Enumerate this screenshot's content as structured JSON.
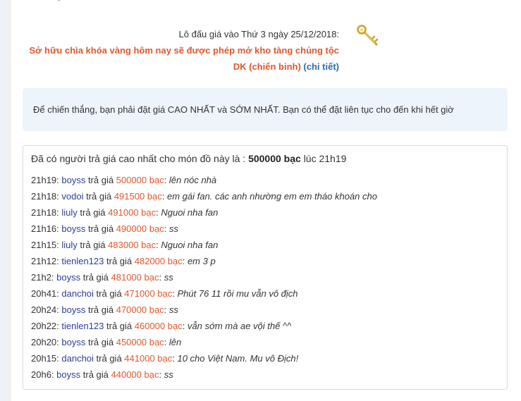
{
  "auction": {
    "date_line": "Lô đấu giá vào Thứ 3 ngày 25/12/2018:",
    "prize_line": "Sở hữu chìa khóa vàng hôm nay sẽ được phép mở kho tàng chủng tộc",
    "clan_name": "DK (chiến binh)",
    "paren_open": "(",
    "details_link": "chi tiết",
    "paren_close": ")"
  },
  "notice": {
    "text": "Để chiến thắng, bạn phải đặt giá CAO NHẤT và SỚM NHẤT. Bạn có thể đặt liên tục cho đến khi hết giờ"
  },
  "top_bid": {
    "prefix": "Đã có người trả giá cao nhất cho món đồ này là : ",
    "amount": "500000 bạc",
    "suffix": " lúc 21h19"
  },
  "labels": {
    "bid_verb": " trả giá ",
    "colon": ": "
  },
  "bids": [
    {
      "time": "21h19:",
      "user": "boyss",
      "amount": "500000 bạc",
      "message": "lên nóc nhà"
    },
    {
      "time": "21h18:",
      "user": "vodoi",
      "amount": "491500 bạc",
      "message": "em gái fan. các anh nhường em em tháo khoán cho"
    },
    {
      "time": "21h18:",
      "user": "liuly",
      "amount": "491000 bạc",
      "message": "Nguoi nha fan"
    },
    {
      "time": "21h16:",
      "user": "boyss",
      "amount": "490000 bạc",
      "message": "ss"
    },
    {
      "time": "21h15:",
      "user": "liuly",
      "amount": "483000 bạc",
      "message": "Nguoi nha fan"
    },
    {
      "time": "21h12:",
      "user": "tienlen123",
      "amount": "482000 bạc",
      "message": "em 3 p"
    },
    {
      "time": "21h2:",
      "user": "boyss",
      "amount": "481000 bạc",
      "message": "ss"
    },
    {
      "time": "20h41:",
      "user": "danchoi",
      "amount": "471000 bạc",
      "message": "Phút 76 11 rồi mu vẫn vô địch"
    },
    {
      "time": "20h24:",
      "user": "boyss",
      "amount": "470000 bạc",
      "message": "ss"
    },
    {
      "time": "20h22:",
      "user": "tienlen123",
      "amount": "460000 bạc",
      "message": "vẫn sớm mà ae vội thế ^^"
    },
    {
      "time": "20h20:",
      "user": "boyss",
      "amount": "450000 bạc",
      "message": "lên"
    },
    {
      "time": "20h15:",
      "user": "danchoi",
      "amount": "441000 bạc",
      "message": "10 cho Việt Nam. Mu vô Địch!"
    },
    {
      "time": "20h6:",
      "user": "boyss",
      "amount": "440000 bạc",
      "message": "ss"
    }
  ]
}
